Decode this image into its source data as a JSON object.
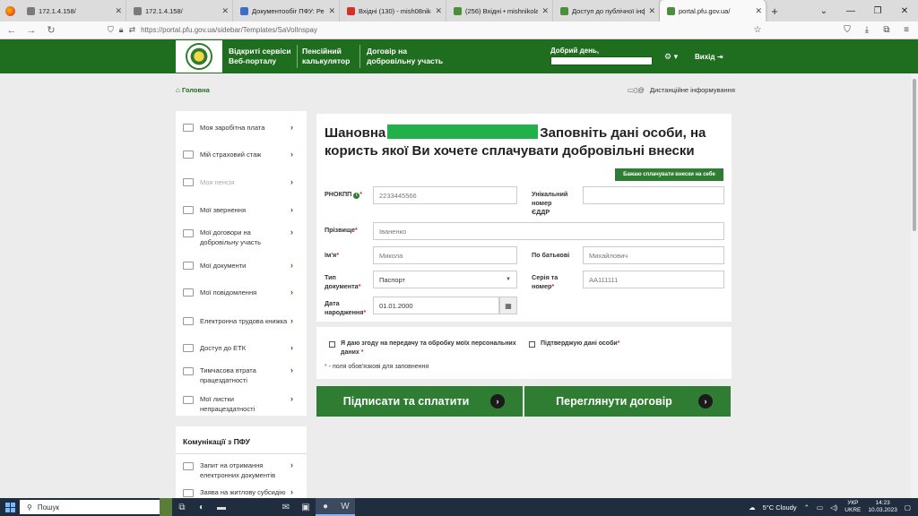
{
  "browser": {
    "tabs": [
      {
        "title": "172.1.4.158/",
        "fav": "#7a7a7a"
      },
      {
        "title": "172.1.4.158/",
        "fav": "#7a7a7a"
      },
      {
        "title": "Документообіг ПФУ: Реєстр",
        "fav": "#3b6ec9"
      },
      {
        "title": "Вхідні (130) - mish08nikol",
        "fav": "#d93025"
      },
      {
        "title": "(256) Вхідні • mishnikolann@u",
        "fav": "#4a8f3a"
      },
      {
        "title": "Доступ до публічної інформа",
        "fav": "#4a8f3a"
      },
      {
        "title": "portal.pfu.gov.ua/",
        "fav": "#4a8f3a"
      }
    ],
    "url": "https://portal.pfu.gov.ua/sidebar/Templates/SaVolInspay"
  },
  "header": {
    "nav": [
      {
        "line1": "Відкриті сервіси",
        "line2": "Веб-порталу"
      },
      {
        "line1": "Пенсійний",
        "line2": "калькулятор"
      },
      {
        "line1": "Договір на",
        "line2": "добровільну участь"
      }
    ],
    "greeting": "Добрий день,",
    "exit_label": "Вихід"
  },
  "breadcrumb": {
    "home": "Головна"
  },
  "remote_info": "Дистанційне інформування",
  "sidebar": {
    "items": [
      {
        "label1": "Моя заробітна плата",
        "label2": ""
      },
      {
        "label1": "Мій страховий стаж",
        "label2": ""
      },
      {
        "label1": "Моя пенсія",
        "label2": ""
      },
      {
        "label1": "Мої звернення",
        "label2": ""
      },
      {
        "label1": "Мої договори на",
        "label2": "добровільну участь"
      },
      {
        "label1": "Мої документи",
        "label2": ""
      },
      {
        "label1": "Мої повідомлення",
        "label2": ""
      },
      {
        "label1": "Електронна трудова книжка",
        "label2": ""
      },
      {
        "label1": "Доступ до ЕТК",
        "label2": ""
      },
      {
        "label1": "Тимчасова втрата",
        "label2": "працездатності"
      },
      {
        "label1": "Мої листки",
        "label2": "непрацездатності"
      }
    ],
    "comm_title": "Комунікації з ПФУ",
    "comm_items": [
      {
        "label1": "Запит на отримання",
        "label2": "електронних документів"
      },
      {
        "label1": "Заява на житлову субсидію",
        "label2": ""
      }
    ]
  },
  "form": {
    "title_prefix": "Шановна",
    "title_rest": "Заповніть дані особи, на користь якої Ви хочете сплачувати добровільні внески",
    "self_pay_button": "Бажаю сплачувати внески на себе",
    "rnokpp_label": "РНОКПП",
    "rnokpp_placeholder": "2233445566",
    "edrr_label1": "Унікальний",
    "edrr_label2": "номер",
    "edrr_label3": "ЄДДР",
    "surname_label": "Прізвище",
    "surname_value": "Іваненко",
    "name_label": "Ім'я",
    "name_value": "Микола",
    "patronymic_label": "По батькові",
    "patronymic_value": "Михайлович",
    "doctype_label1": "Тип",
    "doctype_label2": "документа",
    "doctype_value": "Паспорт",
    "series_label1": "Серія та",
    "series_label2": "номер",
    "series_value": "АА111111",
    "birth_label1": "Дата",
    "birth_label2": "народження",
    "birth_value": "01.01.2000",
    "consent_line1": "Я даю згоду на передачу та обробку моїх персональних",
    "consent_line2": "даних",
    "confirm_label": "Підтверджую дані особи",
    "required_note": "- поля обов'язкові для заповнення",
    "req_mark": "*"
  },
  "buttons": {
    "sign_pay": "Підписати та сплатити",
    "view_contract": "Переглянути договір"
  },
  "taskbar": {
    "search": "Пошук",
    "weather": "5°C  Cloudy",
    "lang1": "УКР",
    "lang2": "UKRE",
    "time": "14:23",
    "date": "10.03.2023"
  }
}
